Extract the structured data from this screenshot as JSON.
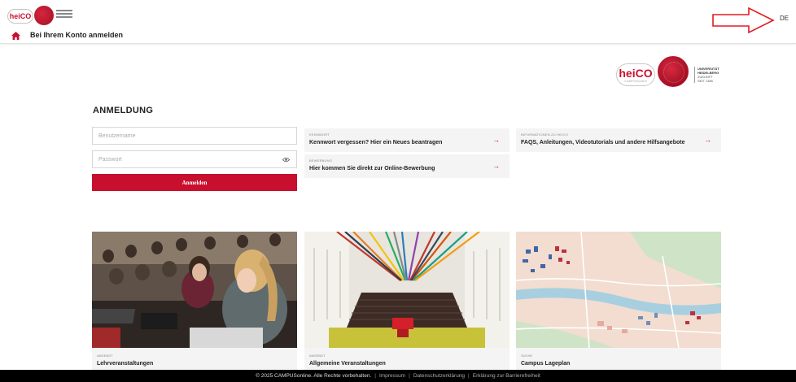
{
  "header": {
    "mini_logo_text": "heiCO",
    "breadcrumb": "Bei Ihrem Konto anmelden",
    "language": "DE"
  },
  "logo": {
    "heico": "heiCO",
    "heico_sub": "CAMPUSonline",
    "university_line1": "UNIVERSITÄT",
    "university_line2": "HEIDELBERG",
    "university_line3": "ZUKUNFT",
    "university_line4": "SEIT 1386"
  },
  "login": {
    "title": "ANMELDUNG",
    "username_placeholder": "Benutzername",
    "password_placeholder": "Passwort",
    "submit_label": "Anmelden"
  },
  "tiles": {
    "password": {
      "category": "KENNWORT",
      "text": "Kennwort vergessen? Hier ein Neues beantragen"
    },
    "application": {
      "category": "BEWERBUNG",
      "text": "Hier kommen Sie direkt zur Online-Bewerbung"
    },
    "info": {
      "category": "INFORMATIONEN ZU HEICO",
      "text": "FAQS, Anleitungen, Videotutorials und andere Hilfsangebote"
    },
    "arrow": "→"
  },
  "cards": [
    {
      "category": "ANGEBOT",
      "title": "Lehrveranstaltungen"
    },
    {
      "category": "ANGEBOT",
      "title": "Allgemeine Veranstaltungen"
    },
    {
      "category": "SUCHE",
      "title": "Campus Lageplan"
    }
  ],
  "footer": {
    "copyright": "© 2025 CAMPUSonline. Alle Rechte vorbehalten.",
    "separator": "|",
    "links": [
      "Impressum",
      "Datenschutzerklärung",
      "Erklärung zur Barrierefreiheit"
    ]
  },
  "colors": {
    "brand_red": "#c8102e",
    "footer_bg": "#000000",
    "tile_bg": "#f4f4f4"
  }
}
